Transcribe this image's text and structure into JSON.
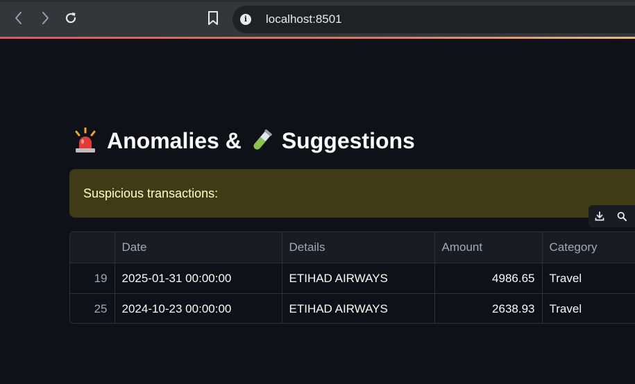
{
  "browser": {
    "url": "localhost:8501",
    "info_icon": "info-icon",
    "nav_icons": [
      "back-arrow-icon",
      "forward-arrow-icon",
      "reload-icon",
      "bookmark-icon"
    ]
  },
  "page": {
    "title_part1": "Anomalies &",
    "title_part2": "Suggestions",
    "title_icon1": "rotating-light-icon",
    "title_icon2": "test-tube-icon"
  },
  "alert": {
    "text": "Suspicious transactions:"
  },
  "toolbar": {
    "icons": [
      "download-icon",
      "search-icon"
    ]
  },
  "table": {
    "columns": [
      "",
      "Date",
      "Details",
      "Amount",
      "Category"
    ],
    "rows": [
      {
        "index": "19",
        "date": "2025-01-31 00:00:00",
        "details": "ETIHAD AIRWAYS",
        "amount": "4986.65",
        "category": "Travel"
      },
      {
        "index": "25",
        "date": "2024-10-23 00:00:00",
        "details": "ETIHAD AIRWAYS",
        "amount": "2638.93",
        "category": "Travel"
      }
    ]
  },
  "colors": {
    "background": "#0e1117",
    "alert_bg": "#3e3b16",
    "alert_text": "#ffffc2",
    "accent_red": "#ff4b4b"
  }
}
